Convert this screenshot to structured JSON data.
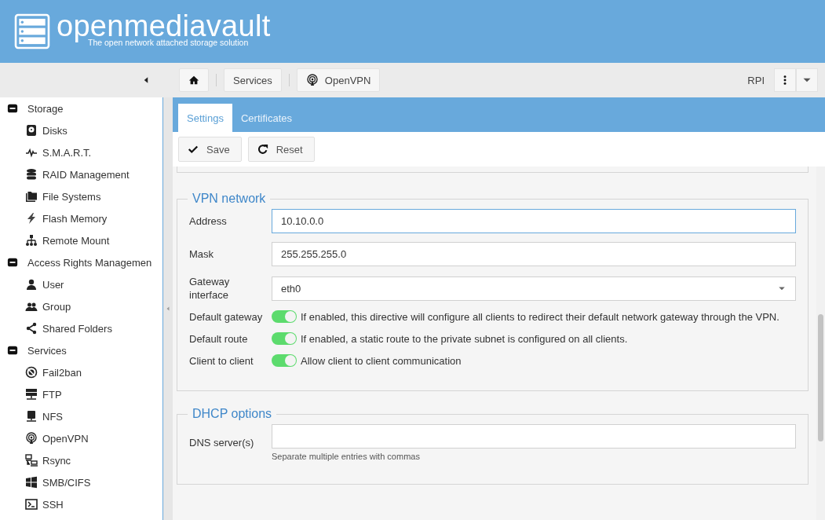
{
  "header": {
    "title": "openmediavault",
    "subtitle": "The open network attached storage solution"
  },
  "breadcrumb": [
    {
      "kind": "home"
    },
    {
      "kind": "text",
      "label": "Services"
    },
    {
      "kind": "openvpn",
      "label": "OpenVPN"
    }
  ],
  "host": "RPI",
  "sidebar": {
    "groups": [
      {
        "label": "Storage",
        "expanded": true,
        "children": [
          {
            "label": "Disks"
          },
          {
            "label": "S.M.A.R.T."
          },
          {
            "label": "RAID Management"
          },
          {
            "label": "File Systems"
          },
          {
            "label": "Flash Memory"
          },
          {
            "label": "Remote Mount"
          }
        ]
      },
      {
        "label": "Access Rights Managemen",
        "expanded": true,
        "children": [
          {
            "label": "User"
          },
          {
            "label": "Group"
          },
          {
            "label": "Shared Folders"
          }
        ]
      },
      {
        "label": "Services",
        "expanded": true,
        "children": [
          {
            "label": "Fail2ban"
          },
          {
            "label": "FTP"
          },
          {
            "label": "NFS"
          },
          {
            "label": "OpenVPN"
          },
          {
            "label": "Rsync"
          },
          {
            "label": "SMB/CIFS"
          },
          {
            "label": "SSH"
          }
        ]
      }
    ]
  },
  "tabs": [
    {
      "label": "Settings",
      "selected": true
    },
    {
      "label": "Certificates",
      "selected": false
    }
  ],
  "actions": [
    {
      "kind": "save",
      "label": "Save"
    },
    {
      "kind": "reset",
      "label": "Reset"
    }
  ],
  "sections": [
    {
      "title": "VPN network",
      "rows": [
        {
          "kind": "text",
          "label": "Address",
          "value": "10.10.0.0",
          "focused": true
        },
        {
          "kind": "text",
          "label": "Mask",
          "value": "255.255.255.0",
          "focused": false
        },
        {
          "kind": "select",
          "label": "Gateway interface",
          "value": "eth0"
        },
        {
          "kind": "toggle",
          "label": "Default gateway",
          "on": true,
          "description": "If enabled, this directive will configure all clients to redirect their default network gateway through the VPN."
        },
        {
          "kind": "toggle",
          "label": "Default route",
          "on": true,
          "description": "If enabled, a static route to the private subnet is configured on all clients."
        },
        {
          "kind": "toggle",
          "label": "Client to client",
          "on": true,
          "description": "Allow client to client communication"
        }
      ]
    },
    {
      "title": "DHCP options",
      "rows": [
        {
          "kind": "text",
          "label": "DNS server(s)",
          "value": "",
          "focused": false,
          "hint": "Separate multiple entries with commas"
        }
      ]
    }
  ]
}
